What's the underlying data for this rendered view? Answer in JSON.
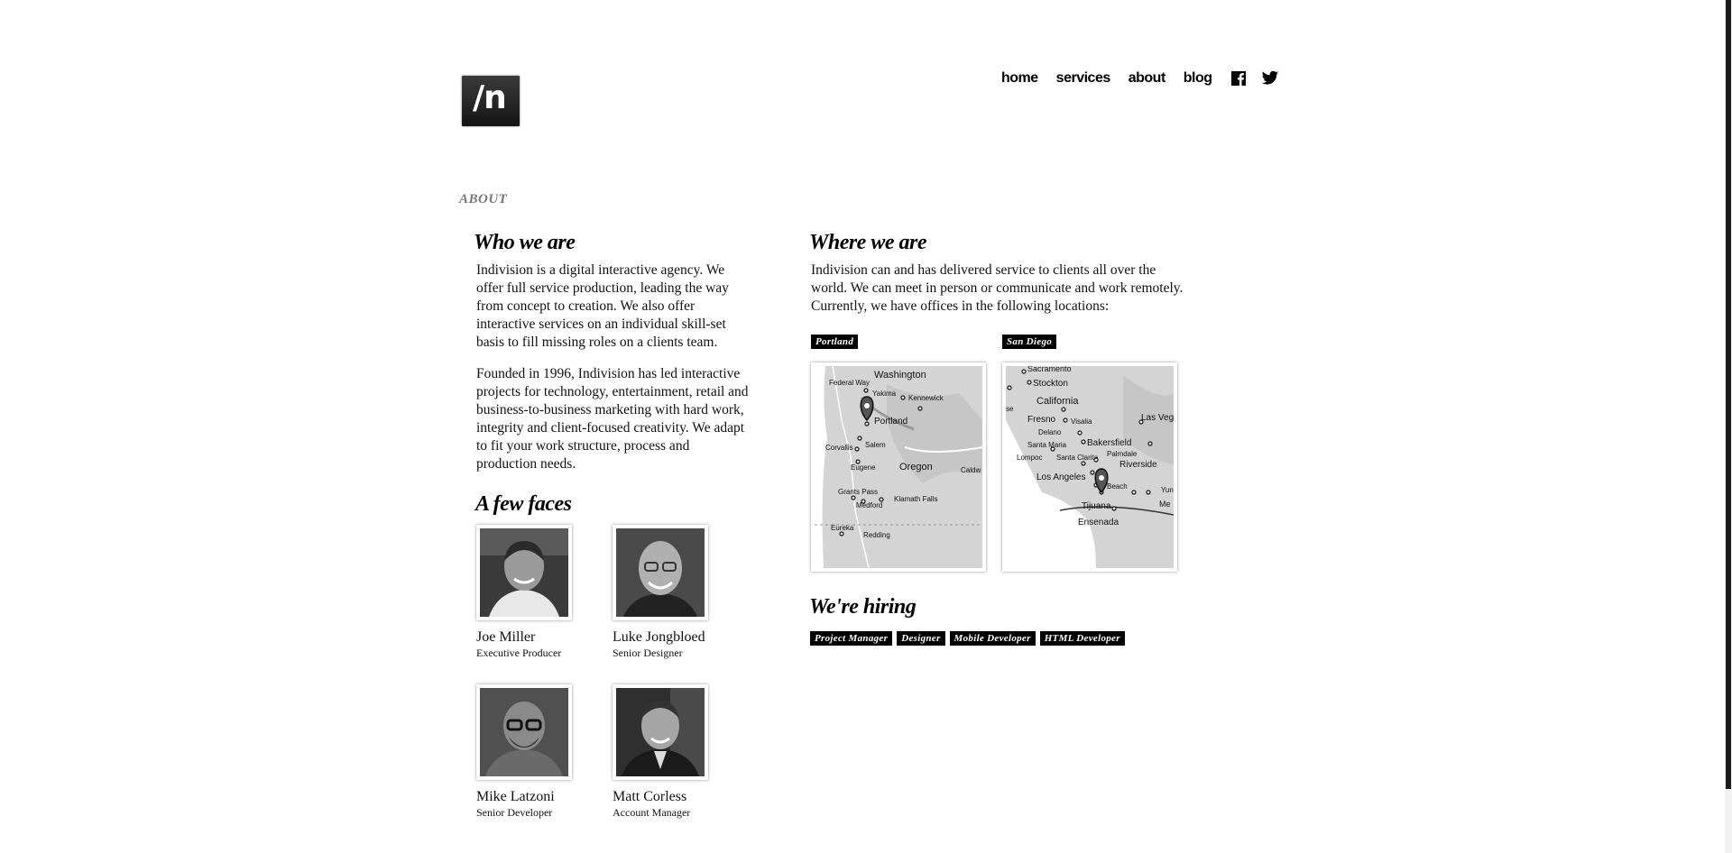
{
  "logo": {
    "text": "/n"
  },
  "nav": {
    "items": [
      "home",
      "services",
      "about",
      "blog"
    ],
    "social": [
      "facebook-icon",
      "twitter-icon"
    ]
  },
  "page": {
    "section_label": "ABOUT"
  },
  "who": {
    "heading": "Who we are",
    "para1": "Indivision is a digital interactive agency. We offer full service production, leading the way from concept to creation. We also offer interactive services on an individual skill-set basis to fill missing roles on a clients team.",
    "para2": "Founded in 1996, Indivision has led interactive projects for technology, entertainment, retail and business-to-business marketing with hard work, integrity and client-focused creativity. We adapt to fit your work structure, process and production needs."
  },
  "faces": {
    "heading": "A few faces",
    "people": [
      {
        "name": "Joe Miller",
        "role": "Executive Producer"
      },
      {
        "name": "Luke Jongbloed",
        "role": "Senior Designer"
      },
      {
        "name": "Mike Latzoni",
        "role": "Senior Developer"
      },
      {
        "name": "Matt Corless",
        "role": "Account Manager"
      }
    ]
  },
  "where": {
    "heading": "Where we are",
    "para": "Indivision can and has delivered service to clients all over the world. We can meet in person or communicate and work remotely. Currently, we have offices in the following locations:",
    "locations": [
      {
        "label": "Portland",
        "map_labels": [
          "Washington",
          "Federal Way",
          "Yakima",
          "Kennewick",
          "Portland",
          "Salem",
          "Corvallis",
          "Eugene",
          "Oregon",
          "Caldw",
          "Grants Pass",
          "Medford",
          "Klamath Falls",
          "Eureka",
          "Redding"
        ]
      },
      {
        "label": "San Diego",
        "map_labels": [
          "Sacramento",
          "Stockton",
          "California",
          "Fresno",
          "Visalia",
          "Las Veg",
          "Delano",
          "Bakersfield",
          "Santa Maria",
          "Palmdale",
          "Lompoc",
          "Santa Clarita",
          "Riverside",
          "Los Angeles",
          "Beach",
          "Tijuana",
          "Ensenada",
          "Me",
          "Yun",
          "se"
        ]
      }
    ]
  },
  "hiring": {
    "heading": "We're hiring",
    "jobs": [
      "Project Manager",
      "Designer",
      "Mobile Developer",
      "HTML Developer"
    ]
  },
  "colors": {
    "tag_bg": "#000000",
    "logo_bg": "#222222",
    "map_land": "#d6d6d6"
  }
}
